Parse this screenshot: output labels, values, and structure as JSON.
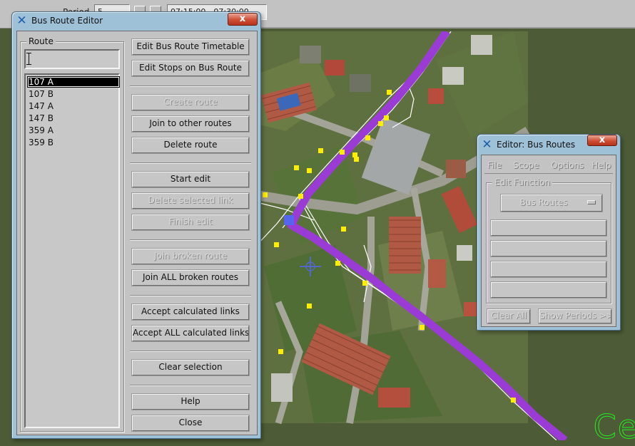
{
  "topbar": {
    "label": "Period",
    "field1": "5",
    "field2": "07:15:00 - 07:30:00"
  },
  "map": {
    "corner_text": "Ce",
    "colors": {
      "route": "#9b3bd6",
      "stop": "#ffee00",
      "node": "#5566ee",
      "link": "#ffffff"
    }
  },
  "bus_route_editor": {
    "title": "Bus Route Editor",
    "close_label": "x",
    "route_group_label": "Route",
    "route_input_value": "",
    "routes": [
      "107 A",
      "107 B",
      "147 A",
      "147 B",
      "359 A",
      "359 B"
    ],
    "selected_route": "107 A",
    "buttons": {
      "edit_timetable": "Edit Bus Route Timetable",
      "edit_stops": "Edit Stops on Bus Route",
      "create_route": "Create route",
      "join_other": "Join to other routes",
      "delete_route": "Delete route",
      "start_edit": "Start edit",
      "delete_link": "Delete selected link",
      "finish_edit": "Finish edit",
      "join_broken": "Join broken route",
      "join_all_broken": "Join ALL broken routes",
      "accept_links": "Accept calculated links",
      "accept_all_links": "Accept ALL calculated links",
      "clear_selection": "Clear selection",
      "help": "Help",
      "close": "Close"
    }
  },
  "editor_bus_routes": {
    "title": "Editor: Bus Routes",
    "close_label": "x",
    "menu": [
      "File",
      "Scope",
      "Options",
      "Help"
    ],
    "edit_function_label": "Edit Function",
    "edit_function_value": "Bus Routes",
    "clear_all": "Clear All",
    "show_periods": "Show Periods >>"
  }
}
